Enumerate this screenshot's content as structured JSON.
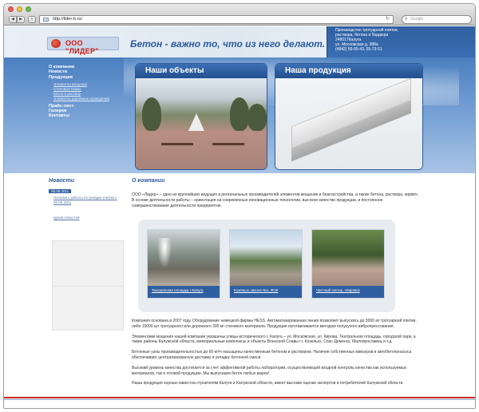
{
  "browser": {
    "url": "http://lider-b.ru/",
    "search_placeholder": "Google",
    "reload_glyph": "↻",
    "back_glyph": "◀",
    "forward_glyph": "▶",
    "add_glyph": "+"
  },
  "header": {
    "logo_text": "ООО \"ЛИДЕР\"",
    "slogan": "Бетон - важно то, что из него делают.",
    "contacts": [
      "Производство тротуарной плитки,",
      "раствора, бетона и бордюра",
      "248017Калуга",
      "ул. Московская д. 388a",
      "(4842) 59-05-43, 55-73-51"
    ]
  },
  "menu": [
    {
      "label": "О компании",
      "sub": false
    },
    {
      "label": "Новости",
      "sub": false
    },
    {
      "label": "Продукция",
      "sub": false
    },
    {
      "label": "Элементы мощения",
      "sub": true
    },
    {
      "label": "Стеновые камни",
      "sub": true
    },
    {
      "label": "Бетон и раствор",
      "sub": true
    },
    {
      "label": "Элементы дорожных ограждений",
      "sub": true
    },
    {
      "label": "Прайс-лист",
      "sub": false
    },
    {
      "label": "Галерея",
      "sub": false
    },
    {
      "label": "Контакты",
      "sub": false
    }
  ],
  "panels": {
    "objects_title": "Наши объекты",
    "products_title": "Наша продукция"
  },
  "news": {
    "title": "Новости",
    "date": "06.06.2011",
    "item_text": "Начались работы по укладке плитки с 06.06.2011",
    "all_link": "архив новостей"
  },
  "about": {
    "title": "О компании",
    "intro": "ООО «Лидер» – одно из крупнейших ведущих в региональных производителей элементов мощения и благоустройства, а также бетона, раствора, кирпич. В основе деятельности работы – ориентация на современные инновационные технологии, высокое качество продукции, и постоянное совершенствование деятельности предприятия."
  },
  "gallery": [
    {
      "caption": "Театральная площадь г.Калуга"
    },
    {
      "caption": "Козельск, Школа №1, ФОК"
    },
    {
      "caption": "Частный сектор, г.Кировск"
    }
  ],
  "body_paragraphs": [
    "Компания основана в 2007 году. Оборудование немецкой фирмы HESS. Автоматизированная линия позволяет выпускать до 3000 м² тротуарной плитки, либо 15000 шт тротуарного или дорожного 300 м³ стенового материала. Продукция изготавливается методом полусухого вибропрессования.",
    "Элементами мощения нашей компании украшены улицы исторического г. Калуга – ул. Московская, ул. Кирова, Театральная площадь, городской парк, а также районы Калужской области, мемориальные комплексы и объекты Воинской Славы г.г. Козельск, Спас-Деменск, Малоярославец и т.д.",
    "Бетонные узлы производительностью до 60 м³/ч насыщены качественным бетоном и раствором. Наличие собственных миксеров и автобетононасоса обеспечивает централизованную доставку и укладку бетонной смеси.",
    "Высокий уровень качества достигается за счет эффективной работы лаборатории, осуществляющей входной контроль качества как используемых материалов, так и готовой продукции. Мы выпускаем бетон любых марок!",
    "Наша продукция хорошо известна строителям Калуги и Калужской области, имеет высокие оценки экспертов и потребителей Калужской области."
  ]
}
